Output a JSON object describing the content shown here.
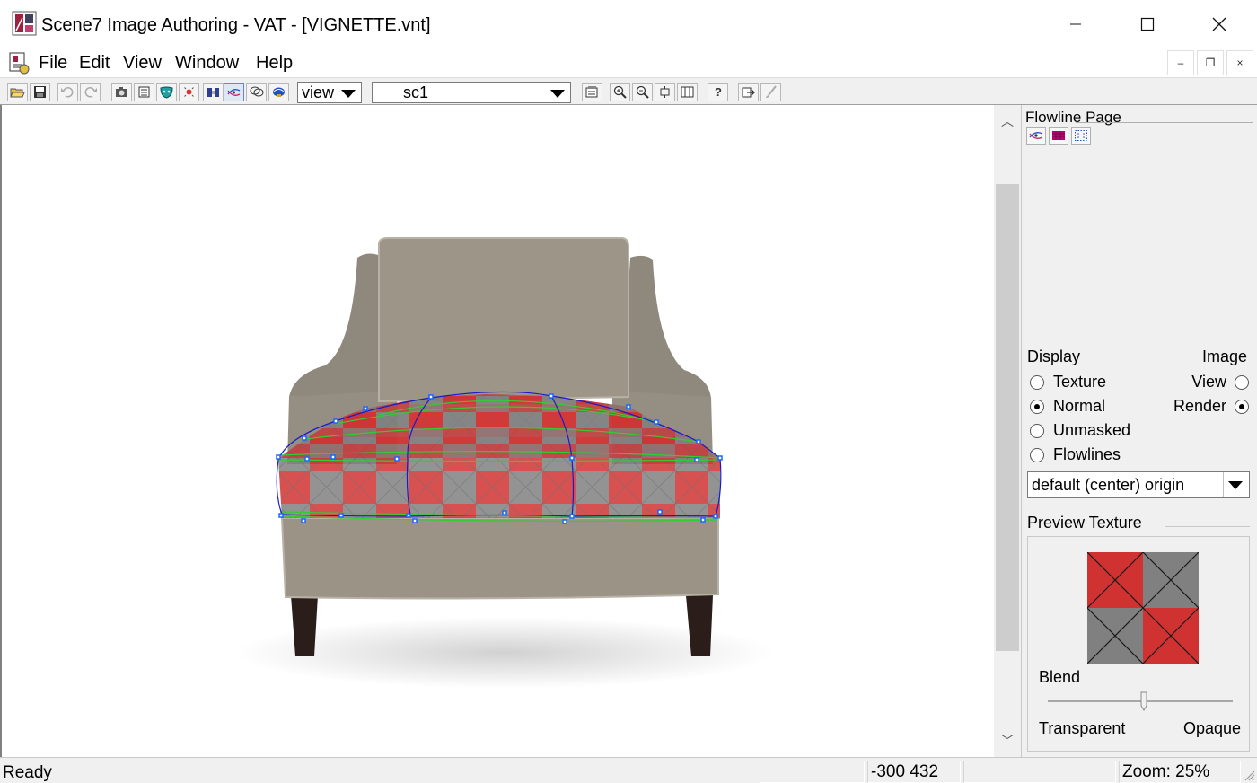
{
  "window": {
    "title": "Scene7 Image Authoring - VAT - [VIGNETTE.vnt]",
    "minimize_glyph": "—",
    "maximize_glyph": "☐",
    "close_glyph": "✕"
  },
  "menu": {
    "items": [
      "File",
      "Edit",
      "View",
      "Window",
      "Help"
    ],
    "mdi_minimize": "–",
    "mdi_restore": "❐",
    "mdi_close": "×"
  },
  "toolbar": {
    "mode_select": "view",
    "scene_select": "sc1",
    "icons": [
      "open-icon",
      "save-icon",
      "undo-icon",
      "redo-icon",
      "camera-icon",
      "layers-icon",
      "mask-icon",
      "light-icon",
      "material-icon",
      "flowline-icon",
      "lasso-icon",
      "render-icon",
      "properties-icon",
      "zoom-in-icon",
      "zoom-out-icon",
      "fit-icon",
      "split-view-icon",
      "help-icon",
      "export-icon",
      "brush-icon"
    ]
  },
  "panel": {
    "title": "Flowline Page",
    "display_label": "Display",
    "image_label": "Image",
    "display_options": [
      {
        "label": "Texture",
        "selected": false
      },
      {
        "label": "Normal",
        "selected": true
      },
      {
        "label": "Unmasked",
        "selected": false
      },
      {
        "label": "Flowlines",
        "selected": false
      }
    ],
    "image_options": [
      {
        "label": "View",
        "selected": false
      },
      {
        "label": "Render",
        "selected": true
      }
    ],
    "origin_select": "default (center) origin",
    "preview_label": "Preview Texture",
    "blend_label": "Blend",
    "blend_min_label": "Transparent",
    "blend_max_label": "Opaque",
    "blend_value": 0.52
  },
  "colors": {
    "texture_red": "#d03232",
    "texture_gray": "#808080",
    "flowline_green": "#33cc33",
    "flowline_blue": "#1a1acc"
  },
  "status": {
    "message": "Ready",
    "coordinates": "-300  432",
    "zoom": "Zoom:  25%"
  }
}
